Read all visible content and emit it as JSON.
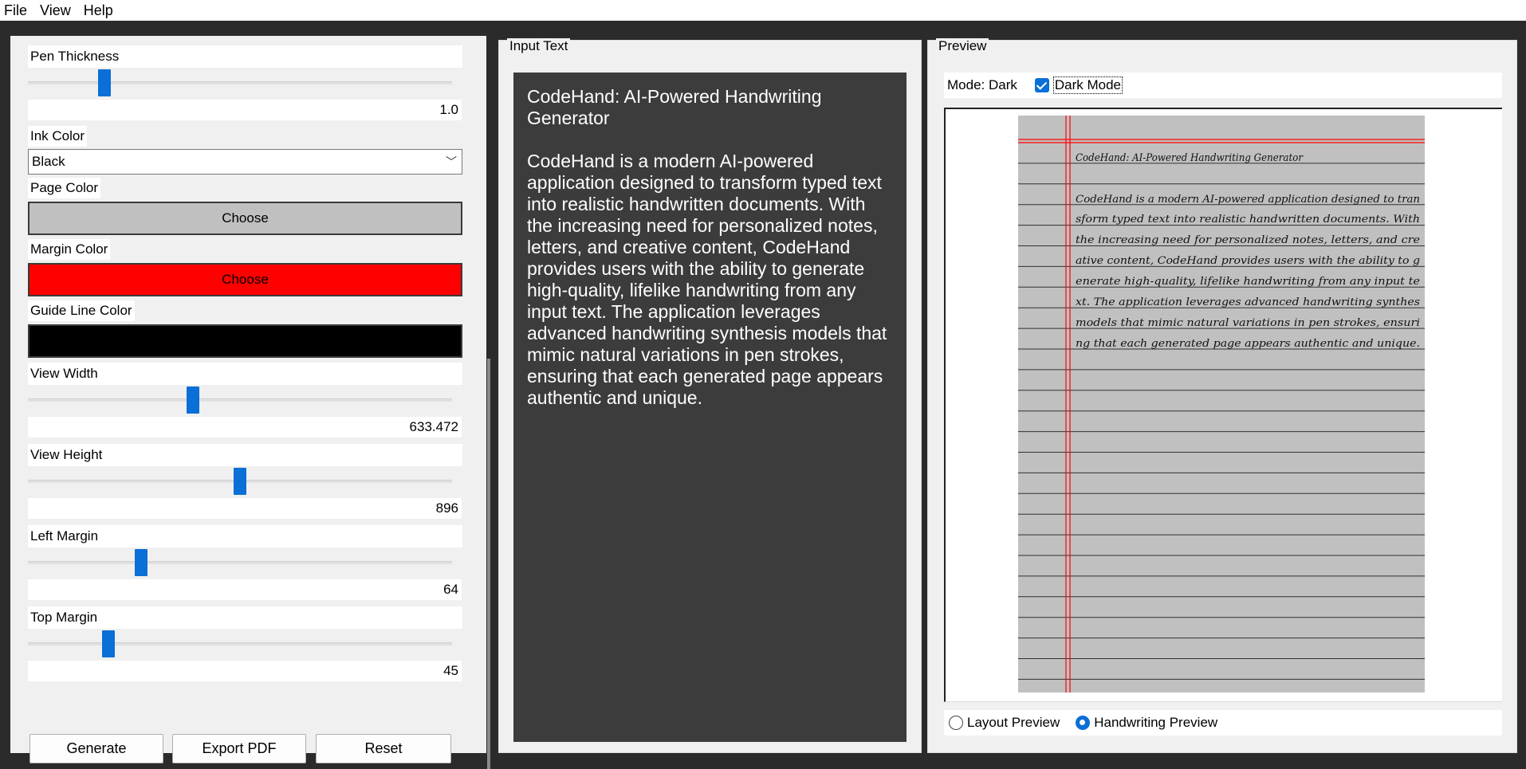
{
  "menu": {
    "items": [
      "File",
      "View",
      "Help"
    ]
  },
  "controls": {
    "pen_thickness": {
      "label": "Pen Thickness",
      "value": "1.0",
      "fraction": 0.17
    },
    "ink_color": {
      "label": "Ink Color",
      "selected": "Black"
    },
    "page_color": {
      "label": "Page Color",
      "button": "Choose",
      "color": "#c0c0c0"
    },
    "margin_color": {
      "label": "Margin Color",
      "button": "Choose",
      "color": "#ff0000"
    },
    "guide_line_color": {
      "label": "Guide Line Color",
      "color": "#000000"
    },
    "view_width": {
      "label": "View Width",
      "value": "633.472",
      "fraction": 0.385
    },
    "view_height": {
      "label": "View Height",
      "value": "896",
      "fraction": 0.5
    },
    "left_margin": {
      "label": "Left Margin",
      "value": "64",
      "fraction": 0.26
    },
    "top_margin": {
      "label": "Top Margin",
      "value": "45",
      "fraction": 0.18
    },
    "buttons": {
      "generate": "Generate",
      "export_pdf": "Export PDF",
      "reset": "Reset"
    }
  },
  "input": {
    "group_title": "Input Text",
    "title": "CodeHand: AI-Powered Handwriting Generator",
    "body": "CodeHand is a modern AI-powered application designed to transform typed text into realistic handwritten documents. With the increasing need for personalized notes, letters, and creative content, CodeHand provides users with the ability to generate high-quality, lifelike handwriting from any input text. The application leverages advanced handwriting synthesis models that mimic natural variations in pen strokes, ensuring that each generated page appears authentic and unique."
  },
  "preview": {
    "group_title": "Preview",
    "mode_label": "Mode: Dark",
    "dark_mode_label": "Dark Mode",
    "dark_mode_checked": true,
    "handwriting_lines": [
      "CodeHand: AI-Powered Handwriting Generator",
      "",
      "CodeHand is a modern AI-powered application designed to tran",
      "sform typed text into realistic handwritten documents. With",
      "the increasing need for personalized notes, letters, and cre",
      "ative content, CodeHand provides users with the ability to g",
      "enerate high-quality, lifelike handwriting from any input te",
      "xt. The application leverages advanced handwriting synthes",
      "models that mimic natural variations in pen strokes, ensuri",
      "ng that each generated page appears authentic and unique."
    ],
    "radio": {
      "layout": "Layout Preview",
      "handwriting": "Handwriting Preview",
      "selected": "handwriting"
    }
  }
}
